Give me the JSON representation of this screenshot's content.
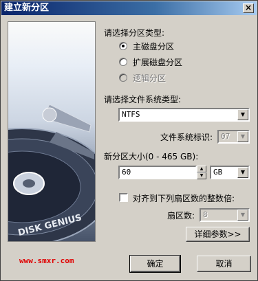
{
  "window": {
    "title": "建立新分区",
    "close_label": "×"
  },
  "artwork": {
    "logo_text": "DISK GENIUS"
  },
  "partition_type": {
    "label": "请选择分区类型:",
    "options": [
      {
        "label": "主磁盘分区",
        "checked": true,
        "disabled": false
      },
      {
        "label": "扩展磁盘分区",
        "checked": false,
        "disabled": false
      },
      {
        "label": "逻辑分区",
        "checked": false,
        "disabled": true
      }
    ]
  },
  "filesystem": {
    "label": "请选择文件系统类型:",
    "value": "NTFS",
    "id_label": "文件系统标识:",
    "id_value": "07"
  },
  "size": {
    "label": "新分区大小(0 - 465 GB):",
    "value": "60",
    "unit": "GB"
  },
  "align": {
    "label": "对齐到下列扇区数的整数倍:",
    "checked": false,
    "sectors_label": "扇区数:",
    "sectors_value": "8"
  },
  "buttons": {
    "details": "详细参数>>",
    "ok": "确定",
    "cancel": "取消"
  },
  "watermark": "www.smxr.com"
}
